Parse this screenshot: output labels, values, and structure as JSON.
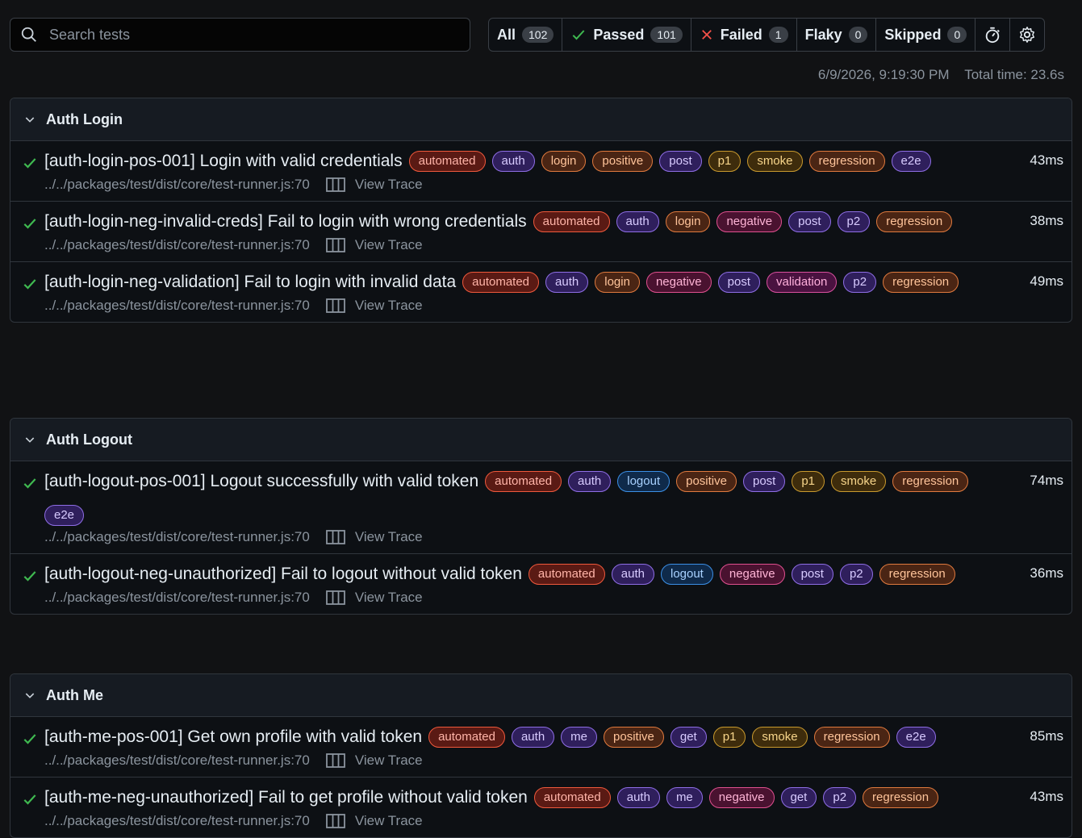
{
  "search": {
    "placeholder": "Search tests"
  },
  "filters": [
    {
      "label": "All",
      "count": "102"
    },
    {
      "label": "Passed",
      "count": "101"
    },
    {
      "label": "Failed",
      "count": "1"
    },
    {
      "label": "Flaky",
      "count": "0"
    },
    {
      "label": "Skipped",
      "count": "0"
    }
  ],
  "meta": {
    "timestamp": "6/9/2026, 9:19:30 PM",
    "total_time": "Total time: 23.6s"
  },
  "trace_label": "View Trace",
  "location": "../../packages/test/dist/core/test-runner.js:70",
  "suites": [
    {
      "name": "Auth Login",
      "tests": [
        {
          "title": "[auth-login-pos-001] Login with valid credentials",
          "duration": "43ms",
          "tags": [
            "automated",
            "auth",
            "login",
            "positive",
            "post",
            "p1",
            "smoke",
            "regression",
            "e2e"
          ]
        },
        {
          "title": "[auth-login-neg-invalid-creds] Fail to login with wrong credentials",
          "duration": "38ms",
          "tags": [
            "automated",
            "auth",
            "login",
            "negative",
            "post",
            "p2",
            "regression"
          ]
        },
        {
          "title": "[auth-login-neg-validation] Fail to login with invalid data",
          "duration": "49ms",
          "tags": [
            "automated",
            "auth",
            "login",
            "negative",
            "post",
            "validation",
            "p2",
            "regression"
          ]
        }
      ]
    },
    {
      "name": "Auth Logout",
      "tests": [
        {
          "title": "[auth-logout-pos-001] Logout successfully with valid token",
          "duration": "74ms",
          "tags": [
            "automated",
            "auth",
            "logout",
            "positive",
            "post",
            "p1",
            "smoke",
            "regression",
            "e2e"
          ]
        },
        {
          "title": "[auth-logout-neg-unauthorized] Fail to logout without valid token",
          "duration": "36ms",
          "tags": [
            "automated",
            "auth",
            "logout",
            "negative",
            "post",
            "p2",
            "regression"
          ]
        }
      ]
    },
    {
      "name": "Auth Me",
      "tests": [
        {
          "title": "[auth-me-pos-001] Get own profile with valid token",
          "duration": "85ms",
          "tags": [
            "automated",
            "auth",
            "me",
            "positive",
            "get",
            "p1",
            "smoke",
            "regression",
            "e2e"
          ]
        },
        {
          "title": "[auth-me-neg-unauthorized] Fail to get profile without valid token",
          "duration": "43ms",
          "tags": [
            "automated",
            "auth",
            "me",
            "negative",
            "get",
            "p2",
            "regression"
          ]
        }
      ]
    }
  ],
  "tag_colors": {
    "automated": "red",
    "auth": "purple",
    "login": "orange",
    "logout": "blue",
    "me": "purple",
    "positive": "orange",
    "negative": "pink",
    "post": "purple",
    "get": "purple",
    "p1": "amber",
    "p2": "purple",
    "smoke": "amber",
    "regression": "orange",
    "e2e": "purple",
    "validation": "magenta"
  },
  "colors": {
    "pass": "#3fb950",
    "fail": "#f85149",
    "background": "#111214"
  }
}
